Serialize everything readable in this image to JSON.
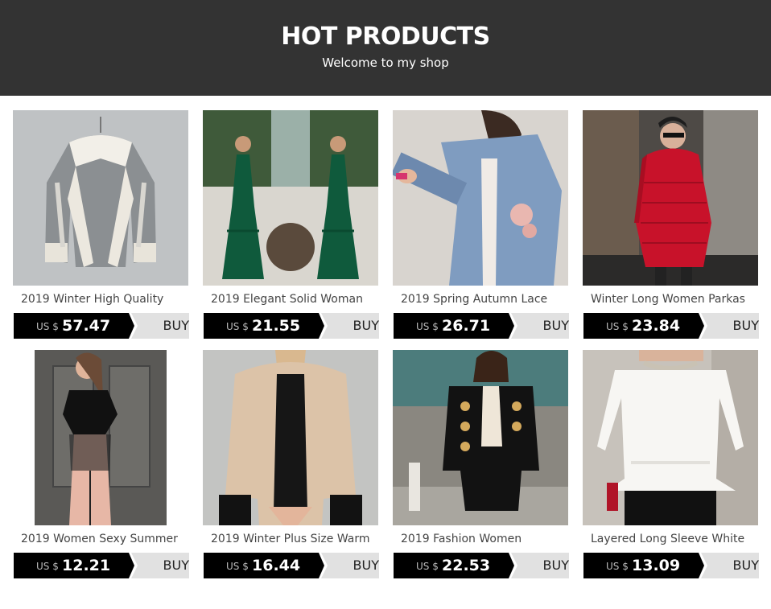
{
  "header": {
    "title": "HOT PRODUCTS",
    "subtitle": "Welcome to my shop"
  },
  "products": [
    {
      "name": "2019 Winter High Quality",
      "currency": "US $",
      "price": "57.47",
      "button": "BUY",
      "image": "sheepskin-jacket-photo"
    },
    {
      "name": "2019 Elegant Solid Woman",
      "currency": "US $",
      "price": "21.55",
      "button": "BUY",
      "image": "green-maxi-dress-photo"
    },
    {
      "name": "2019 Spring Autumn Lace",
      "currency": "US $",
      "price": "26.71",
      "button": "BUY",
      "image": "denim-jacket-photo"
    },
    {
      "name": "Winter Long Women Parkas",
      "currency": "US $",
      "price": "23.84",
      "button": "BUY",
      "image": "red-parka-photo"
    },
    {
      "name": "2019 Women Sexy Summer",
      "currency": "US $",
      "price": "12.21",
      "button": "BUY",
      "image": "lace-bodycon-dress-photo"
    },
    {
      "name": "2019 Winter Plus Size Warm",
      "currency": "US $",
      "price": "16.44",
      "button": "BUY",
      "image": "fleece-coat-photo"
    },
    {
      "name": "2019 Fashion Women",
      "currency": "US $",
      "price": "22.53",
      "button": "BUY",
      "image": "black-military-jacket-photo"
    },
    {
      "name": "Layered Long Sleeve White",
      "currency": "US $",
      "price": "13.09",
      "button": "BUY",
      "image": "white-peplum-blouse-photo"
    }
  ],
  "colors": {
    "banner": "#333333",
    "price_box": "#000000",
    "buy_box": "#e1e1e1"
  }
}
